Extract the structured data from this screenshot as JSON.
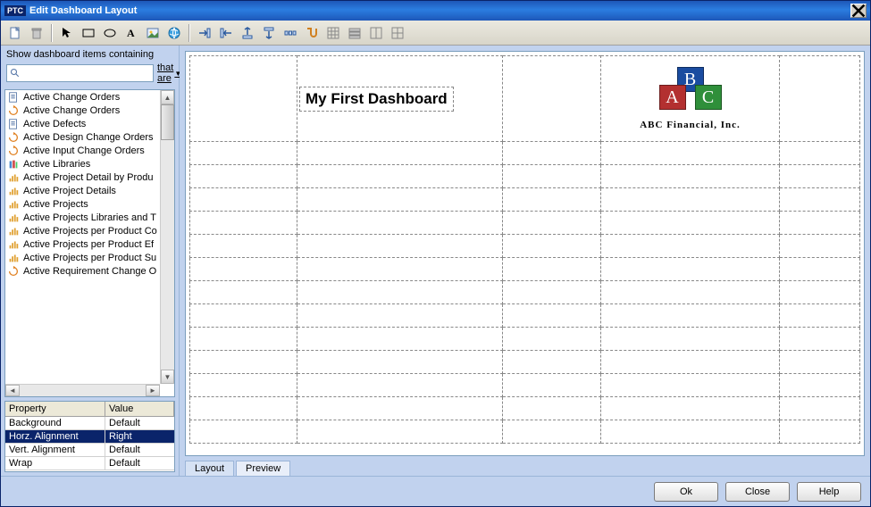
{
  "window": {
    "badge": "PTC",
    "title": "Edit Dashboard Layout"
  },
  "toolbar_icons": [
    "new",
    "delete",
    "select",
    "rect",
    "ellipse",
    "text",
    "image",
    "globe",
    "align-l",
    "align-r",
    "align-t",
    "align-b",
    "snap",
    "lock",
    "grid",
    "rows",
    "cols",
    "cells"
  ],
  "filter": {
    "label": "Show dashboard items containing",
    "that_are": "that are",
    "search_placeholder": ""
  },
  "items": [
    "Active Change Orders",
    "Active Change Orders",
    "Active Defects",
    "Active Design Change Orders",
    "Active Input Change Orders",
    "Active Libraries",
    "Active Project Detail by Produ",
    "Active Project Details",
    "Active Projects",
    "Active Projects Libraries and T",
    "Active Projects per Product Co",
    "Active Projects per Product Ef",
    "Active Projects per Product Su",
    "Active Requirement Change O"
  ],
  "properties": {
    "header_name": "Property",
    "header_value": "Value",
    "rows": [
      {
        "name": "Background",
        "value": "Default",
        "selected": false
      },
      {
        "name": "Horz. Alignment",
        "value": "Right",
        "selected": true
      },
      {
        "name": "Vert. Alignment",
        "value": "Default",
        "selected": false
      },
      {
        "name": "Wrap",
        "value": "Default",
        "selected": false
      }
    ]
  },
  "dashboard": {
    "title_text": "My First Dashboard",
    "logo_text": "ABC Financial, Inc."
  },
  "tabs": {
    "layout": "Layout",
    "preview": "Preview"
  },
  "buttons": {
    "ok": "Ok",
    "close": "Close",
    "help": "Help"
  }
}
